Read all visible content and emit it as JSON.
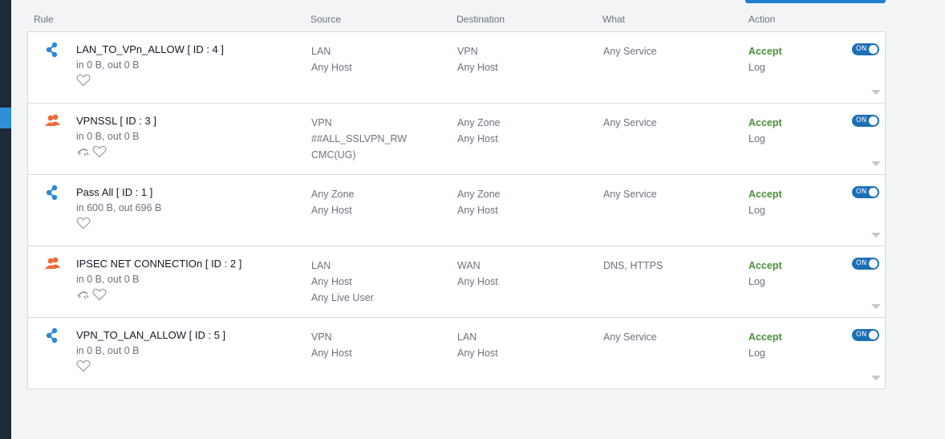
{
  "colors": {
    "accent": "#1f7fd0",
    "toggle_on": "#1b6fb5",
    "accept": "#4a8f3a",
    "network_icon": "#2f86d8",
    "user_icon": "#ef6a3a",
    "sidebar": "#1e2a38"
  },
  "header": {
    "rule": "Rule",
    "source": "Source",
    "destination": "Destination",
    "what": "What",
    "action": "Action"
  },
  "rules": [
    {
      "icon": "network-share-icon",
      "name": "LAN_TO_VPn_ALLOW  [ ID : 4 ]",
      "traffic": "in 0 B, out 0 B",
      "source": [
        "LAN",
        "Any Host"
      ],
      "destination": [
        "VPN",
        "Any Host"
      ],
      "what": "Any Service",
      "action": "Accept",
      "log": "Log",
      "toggle": "ON"
    },
    {
      "icon": "user-group-icon",
      "name": "VPNSSL  [ ID : 3 ]",
      "traffic": "in 0 B, out 0 B",
      "source": [
        "VPN",
        "##ALL_SSLVPN_RW",
        "CMC(UG)"
      ],
      "destination": [
        "Any Zone",
        "Any Host"
      ],
      "what": "Any Service",
      "action": "Accept",
      "log": "Log",
      "toggle": "ON"
    },
    {
      "icon": "network-share-icon",
      "name": "Pass All  [ ID : 1 ]",
      "traffic": "in 600 B, out 696 B",
      "source": [
        "Any Zone",
        "Any Host"
      ],
      "destination": [
        "Any Zone",
        "Any Host"
      ],
      "what": "Any Service",
      "action": "Accept",
      "log": "Log",
      "toggle": "ON"
    },
    {
      "icon": "user-group-icon",
      "name": "IPSEC NET CONNECTIOn  [ ID : 2 ]",
      "traffic": "in 0 B, out 0 B",
      "source": [
        "LAN",
        "Any Host",
        "Any Live User"
      ],
      "destination": [
        "WAN",
        "Any Host"
      ],
      "what": "DNS, HTTPS",
      "action": "Accept",
      "log": "Log",
      "toggle": "ON"
    },
    {
      "icon": "network-share-icon",
      "name": "VPN_TO_LAN_ALLOW  [ ID : 5 ]",
      "traffic": "in 0 B, out 0 B",
      "source": [
        "VPN",
        "Any Host"
      ],
      "destination": [
        "LAN",
        "Any Host"
      ],
      "what": "Any Service",
      "action": "Accept",
      "log": "Log",
      "toggle": "ON"
    }
  ]
}
